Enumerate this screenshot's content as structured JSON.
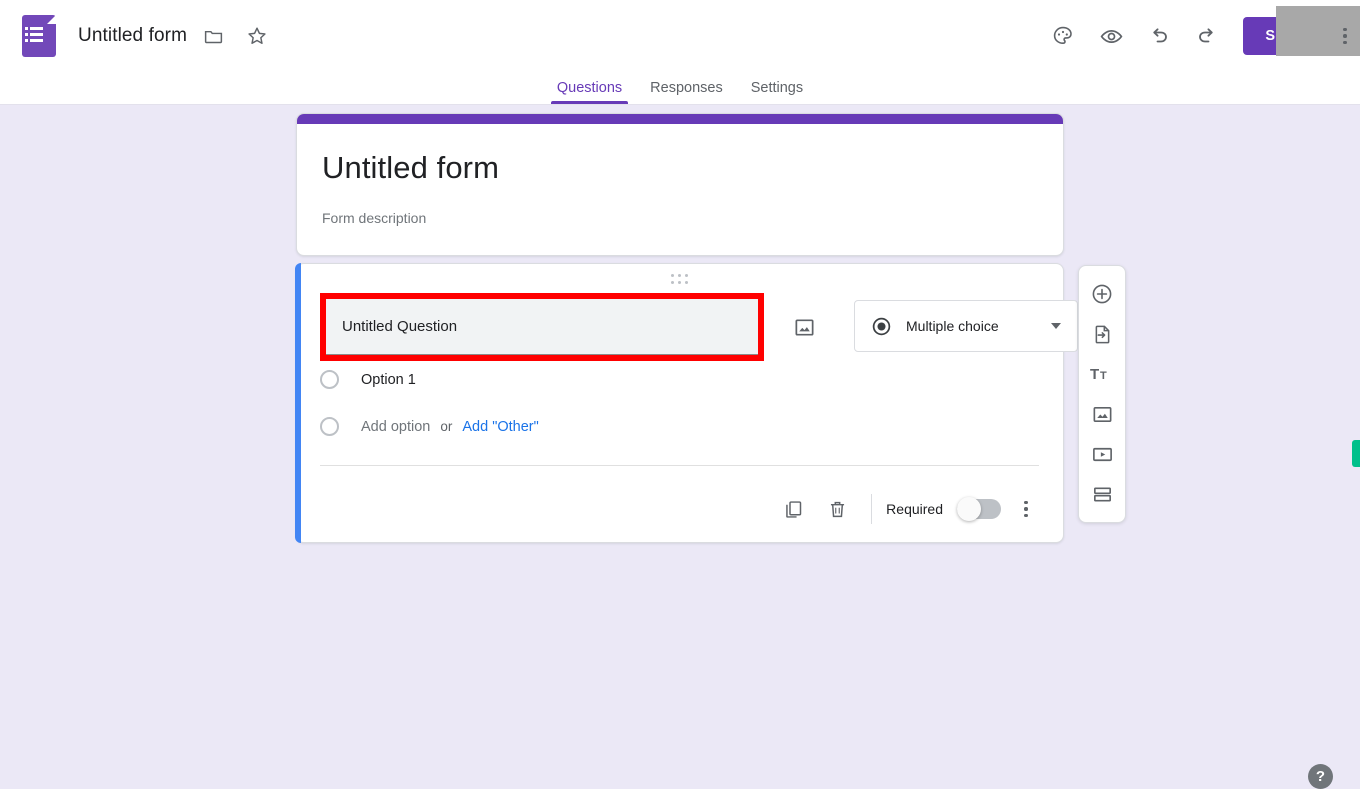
{
  "header": {
    "app_icon": "google-forms-logo",
    "title": "Untitled form",
    "move_to_folder_icon": "folder-icon",
    "star_icon": "star-icon",
    "actions": [
      {
        "name": "customize-theme",
        "icon": "palette-icon"
      },
      {
        "name": "preview",
        "icon": "eye-icon"
      },
      {
        "name": "undo",
        "icon": "undo-icon"
      },
      {
        "name": "redo",
        "icon": "redo-icon"
      }
    ],
    "send_label": "Send",
    "more_icon": "more-vertical-icon",
    "accent_color": "#673ab7"
  },
  "tabs": [
    {
      "label": "Questions",
      "active": true
    },
    {
      "label": "Responses",
      "active": false
    },
    {
      "label": "Settings",
      "active": false
    }
  ],
  "form_header": {
    "title": "Untitled form",
    "description": "Form description",
    "strip_color": "#673ab7"
  },
  "question": {
    "drag_handle_icon": "drag-handle-icon",
    "title_value": "Untitled Question",
    "title_highlight_color": "#ff0000",
    "accent_color": "#4285f4",
    "image_icon": "image-icon",
    "type_icon": "radio-filled-icon",
    "type_label": "Multiple choice",
    "caret_icon": "chevron-down-icon",
    "options": [
      {
        "label": "Option 1",
        "muted": false
      }
    ],
    "add_option_label": "Add option",
    "or_label": "or",
    "add_other_label": "Add \"Other\"",
    "add_other_color": "#1a73e8",
    "footer": {
      "duplicate_icon": "duplicate-icon",
      "delete_icon": "trash-icon",
      "required_label": "Required",
      "required_on": false,
      "more_icon": "more-vertical-icon"
    }
  },
  "side_toolbar": [
    {
      "name": "add-question",
      "icon": "plus-circle-icon"
    },
    {
      "name": "import-questions",
      "icon": "import-file-icon"
    },
    {
      "name": "add-title-and-description",
      "icon": "title-text-icon"
    },
    {
      "name": "add-image",
      "icon": "image-icon"
    },
    {
      "name": "add-video",
      "icon": "video-icon"
    },
    {
      "name": "add-section",
      "icon": "sections-icon"
    }
  ],
  "misc": {
    "help_label": "?",
    "edge_tab_color": "#00c08b",
    "page_background": "#ebe8f6"
  }
}
